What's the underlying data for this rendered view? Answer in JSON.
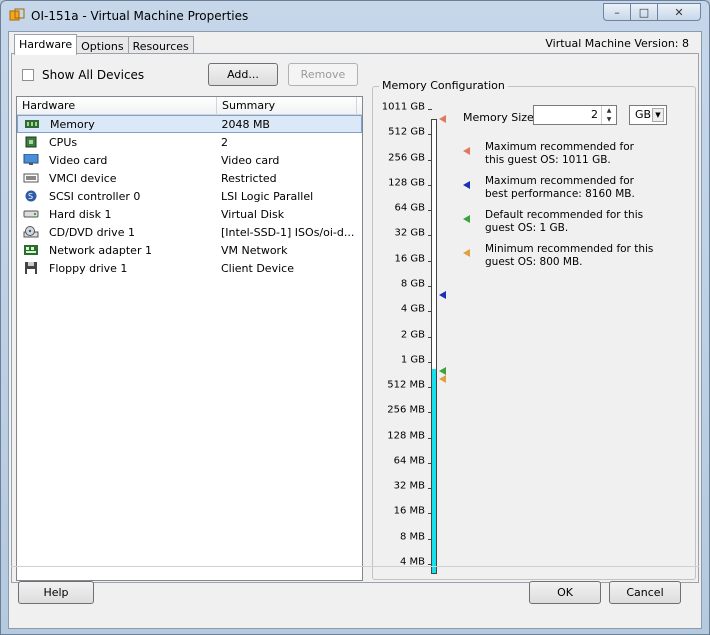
{
  "window": {
    "title": "OI-151a - Virtual Machine Properties",
    "minimize_glyph": "–",
    "maximize_glyph": "□",
    "close_glyph": "✕"
  },
  "tabs": [
    {
      "label": "Hardware",
      "active": true
    },
    {
      "label": "Options",
      "active": false
    },
    {
      "label": "Resources",
      "active": false
    }
  ],
  "vm_version": "Virtual Machine Version: 8",
  "hardware": {
    "show_all_devices_label": "Show All Devices",
    "show_all_devices_checked": false,
    "add_button": "Add...",
    "remove_button": "Remove",
    "columns": [
      "Hardware",
      "Summary"
    ],
    "devices": [
      {
        "name": "Memory",
        "summary": "2048 MB",
        "icon": "memory-icon",
        "selected": true
      },
      {
        "name": "CPUs",
        "summary": "2",
        "icon": "cpu-icon",
        "selected": false
      },
      {
        "name": "Video card",
        "summary": "Video card",
        "icon": "monitor-icon",
        "selected": false
      },
      {
        "name": "VMCI device",
        "summary": "Restricted",
        "icon": "vmci-icon",
        "selected": false
      },
      {
        "name": "SCSI controller 0",
        "summary": "LSI Logic Parallel",
        "icon": "scsi-icon",
        "selected": false
      },
      {
        "name": "Hard disk 1",
        "summary": "Virtual Disk",
        "icon": "hard-disk-icon",
        "selected": false
      },
      {
        "name": "CD/DVD drive 1",
        "summary": "[Intel-SSD-1] ISOs/oi-d...",
        "icon": "cd-dvd-icon",
        "selected": false
      },
      {
        "name": "Network adapter 1",
        "summary": "VM Network",
        "icon": "network-adapter-icon",
        "selected": false
      },
      {
        "name": "Floppy drive 1",
        "summary": "Client Device",
        "icon": "floppy-icon",
        "selected": false
      }
    ]
  },
  "memory_config": {
    "title": "Memory Configuration",
    "scale_labels": [
      "1011 GB",
      "512 GB",
      "256 GB",
      "128 GB",
      "64 GB",
      "32 GB",
      "16 GB",
      "8 GB",
      "4 GB",
      "2 GB",
      "1 GB",
      "512 MB",
      "256 MB",
      "128 MB",
      "64 MB",
      "32 MB",
      "16 MB",
      "8 MB",
      "4 MB"
    ],
    "memory_size_label": "Memory Size:",
    "memory_size_value": "2",
    "unit": "GB",
    "legend": [
      {
        "text": "Maximum recommended for this guest OS: 1011 GB.",
        "color": "#e07a5f",
        "icon": "triangle-marker-icon"
      },
      {
        "text": "Maximum recommended for best performance: 8160 MB.",
        "color": "#1c2fb8",
        "icon": "triangle-marker-icon"
      },
      {
        "text": "Default recommended for this guest OS: 1 GB.",
        "color": "#3aa33a",
        "icon": "triangle-marker-icon"
      },
      {
        "text": "Minimum recommended for this guest OS: 800 MB.",
        "color": "#e0a040",
        "icon": "triangle-marker-icon"
      }
    ],
    "fill_color": "#15e0ec"
  },
  "footer": {
    "help_button": "Help",
    "ok_button": "OK",
    "cancel_button": "Cancel"
  }
}
